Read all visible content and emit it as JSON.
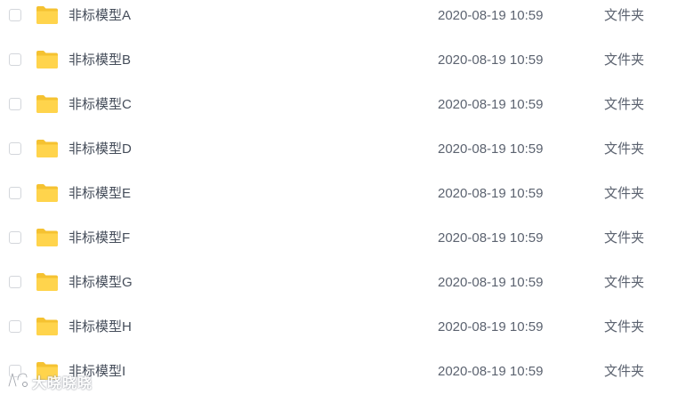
{
  "colors": {
    "folder": "#FFD44C",
    "folder_tab": "#F5C231",
    "name_text": "#454D5A",
    "meta_text": "#5C6370",
    "checkbox_border": "#D3D6DB"
  },
  "files": [
    {
      "name": "非标模型A",
      "date": "2020-08-19 10:59",
      "type": "文件夹",
      "icon": "folder-icon",
      "checked": false
    },
    {
      "name": "非标模型B",
      "date": "2020-08-19 10:59",
      "type": "文件夹",
      "icon": "folder-icon",
      "checked": false
    },
    {
      "name": "非标模型C",
      "date": "2020-08-19 10:59",
      "type": "文件夹",
      "icon": "folder-icon",
      "checked": false
    },
    {
      "name": "非标模型D",
      "date": "2020-08-19 10:59",
      "type": "文件夹",
      "icon": "folder-icon",
      "checked": false
    },
    {
      "name": "非标模型E",
      "date": "2020-08-19 10:59",
      "type": "文件夹",
      "icon": "folder-icon",
      "checked": false
    },
    {
      "name": "非标模型F",
      "date": "2020-08-19 10:59",
      "type": "文件夹",
      "icon": "folder-icon",
      "checked": false
    },
    {
      "name": "非标模型G",
      "date": "2020-08-19 10:59",
      "type": "文件夹",
      "icon": "folder-icon",
      "checked": false
    },
    {
      "name": "非标模型H",
      "date": "2020-08-19 10:59",
      "type": "文件夹",
      "icon": "folder-icon",
      "checked": false
    },
    {
      "name": "非标模型I",
      "date": "2020-08-19 10:59",
      "type": "文件夹",
      "icon": "folder-icon",
      "checked": false
    }
  ],
  "watermark": {
    "text": "大晓晓晓",
    "icon": "watermark-logo-icon"
  }
}
